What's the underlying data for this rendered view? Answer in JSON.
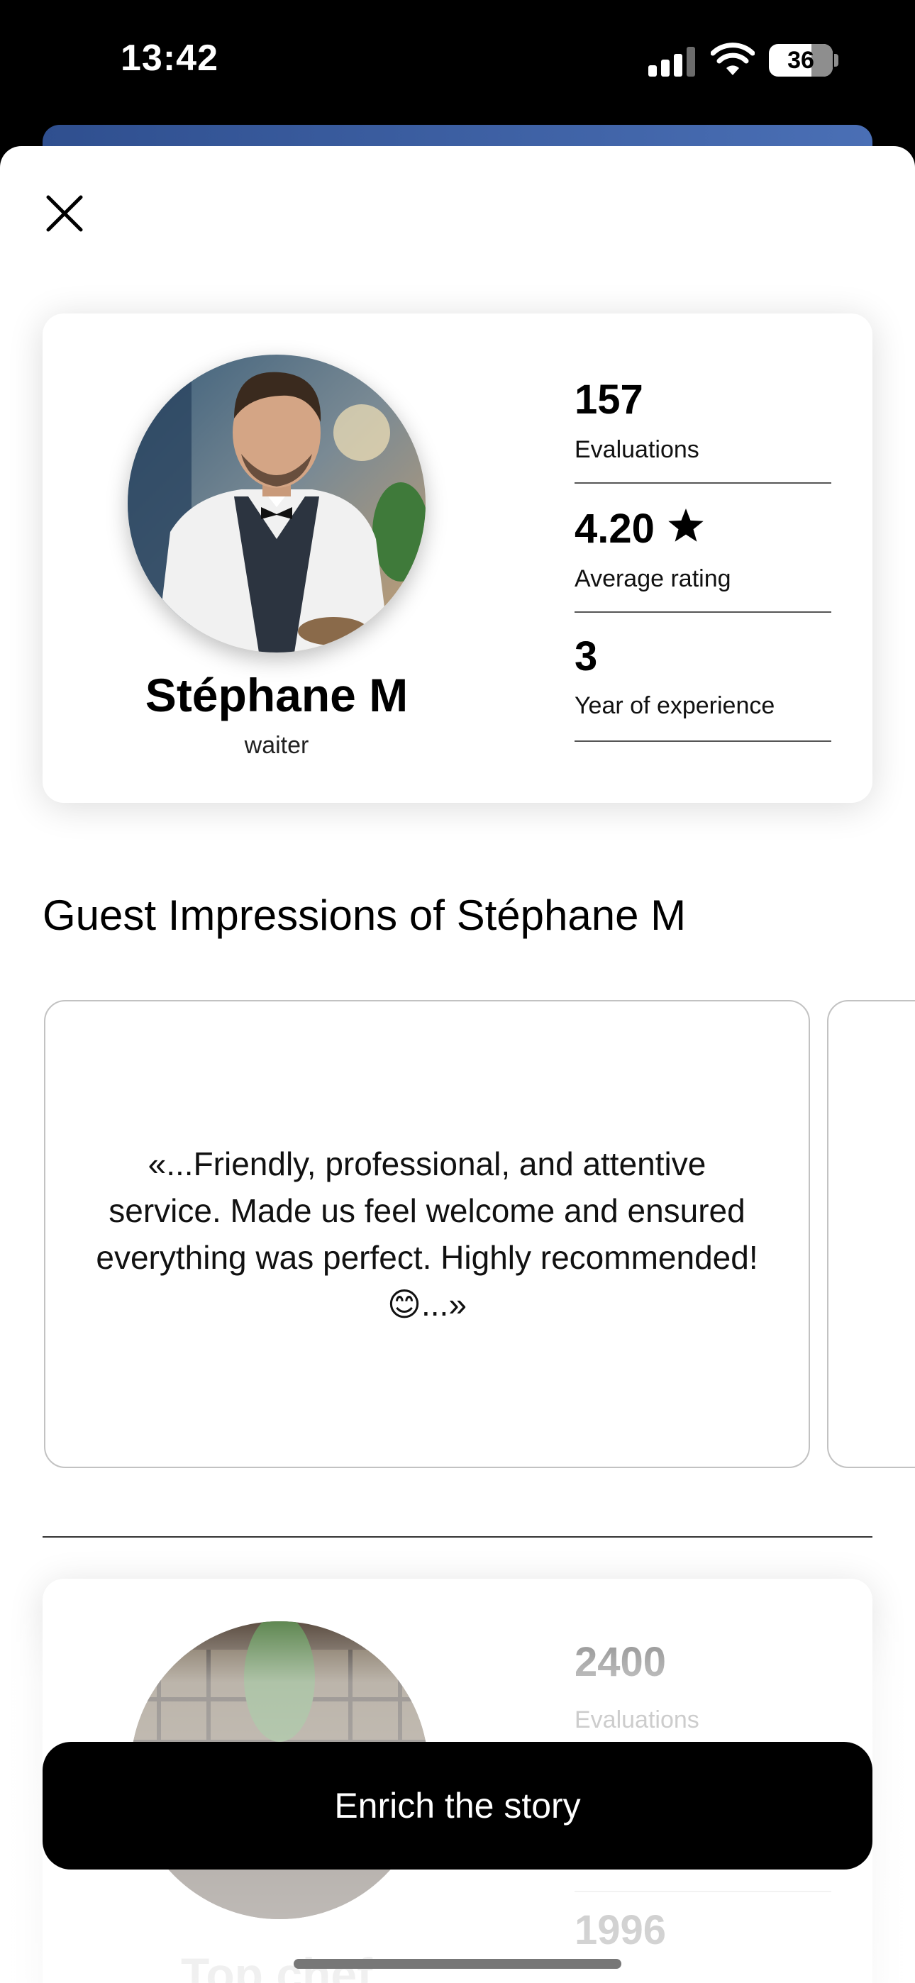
{
  "status_bar": {
    "time": "13:42",
    "battery": "36",
    "icons": [
      "cellular-signal-icon",
      "wifi-icon",
      "battery-icon"
    ]
  },
  "sheet": {
    "close_icon": "close-icon"
  },
  "profile": {
    "name": "Stéphane M",
    "role": "waiter",
    "avatar": "waiter-portrait-photo",
    "stats": [
      {
        "value": "157",
        "label": "Evaluations"
      },
      {
        "value": "4.20",
        "label": "Average rating",
        "icon": "star-icon"
      },
      {
        "value": "3",
        "label": "Year of experience"
      }
    ]
  },
  "impressions": {
    "title": "Guest Impressions of Stéphane M",
    "quotes": [
      "«...Friendly, professional, and attentive service. Made us feel welcome and ensured everything was perfect. Highly recommended! 😊...»"
    ]
  },
  "restaurant": {
    "name": "Top chef",
    "avatar": "restaurant-interior-photo",
    "stats": [
      {
        "value": "2400",
        "label": "Evaluations"
      },
      {
        "value": "1996",
        "label": ""
      }
    ]
  },
  "cta": {
    "label": "Enrich the story"
  },
  "colors": {
    "accent": "#000000",
    "background_card": "#3d5fa3"
  }
}
